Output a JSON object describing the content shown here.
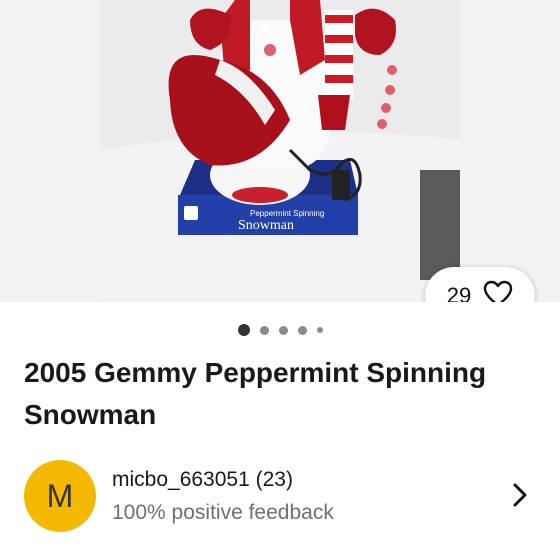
{
  "listing": {
    "title": "2005 Gemmy Peppermint Spinning Snowman",
    "photo_box_label_line1": "Peppermint Spinning",
    "photo_box_label_line2": "Snowman",
    "watchers_count": "29",
    "gallery": {
      "image_count": 5,
      "active_index": 0
    }
  },
  "seller": {
    "avatar_letter": "M",
    "name": "micbo_663051",
    "rating": "(23)",
    "feedback": "100% positive feedback"
  },
  "colors": {
    "avatar_bg": "#f5b800",
    "snowman_red": "#a8101c",
    "box_blue": "#2340a8"
  },
  "icons": [
    "heart-icon",
    "chevron-right-icon"
  ]
}
